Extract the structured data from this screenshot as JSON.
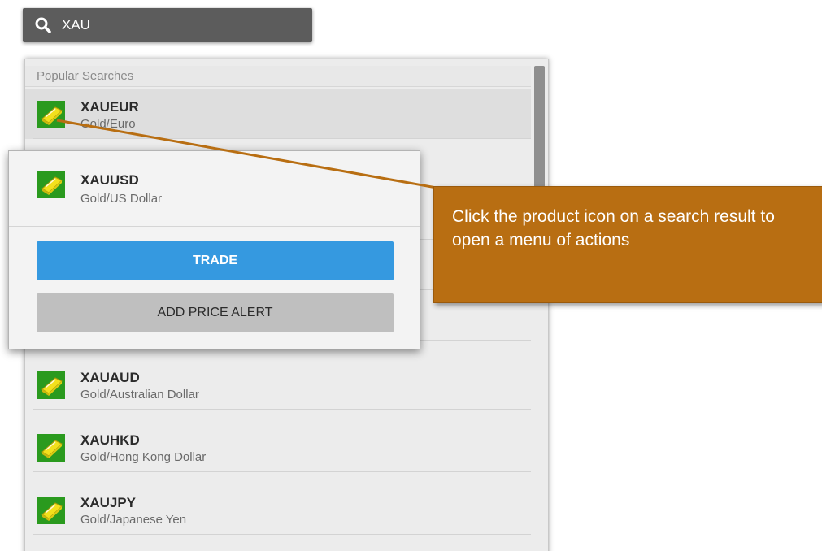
{
  "search": {
    "value": "XAU",
    "icon": "search-icon"
  },
  "results": {
    "section_title": "Popular Searches",
    "items": [
      {
        "code": "XAUEUR",
        "name": "Gold/Euro",
        "icon": "gold-bar-icon"
      },
      {
        "code": "XAUAUD",
        "name": "Gold/Australian Dollar",
        "icon": "gold-bar-icon"
      },
      {
        "code": "XAUHKD",
        "name": "Gold/Hong Kong Dollar",
        "icon": "gold-bar-icon"
      },
      {
        "code": "XAUJPY",
        "name": "Gold/Japanese Yen",
        "icon": "gold-bar-icon"
      }
    ]
  },
  "menu": {
    "product": {
      "code": "XAUUSD",
      "name": "Gold/US Dollar",
      "icon": "gold-bar-icon"
    },
    "trade_label": "TRADE",
    "alert_label": "ADD PRICE ALERT"
  },
  "callout": {
    "text": "Click the product icon on a search result to open a menu of actions"
  },
  "colors": {
    "search_bar": "#5c5c5c",
    "trade_button": "#3599e0",
    "alert_button": "#bfbfbf",
    "callout": "#b86e12",
    "gold_icon_bg": "#2a9a1e",
    "gold_bar": "#f2e01c"
  }
}
